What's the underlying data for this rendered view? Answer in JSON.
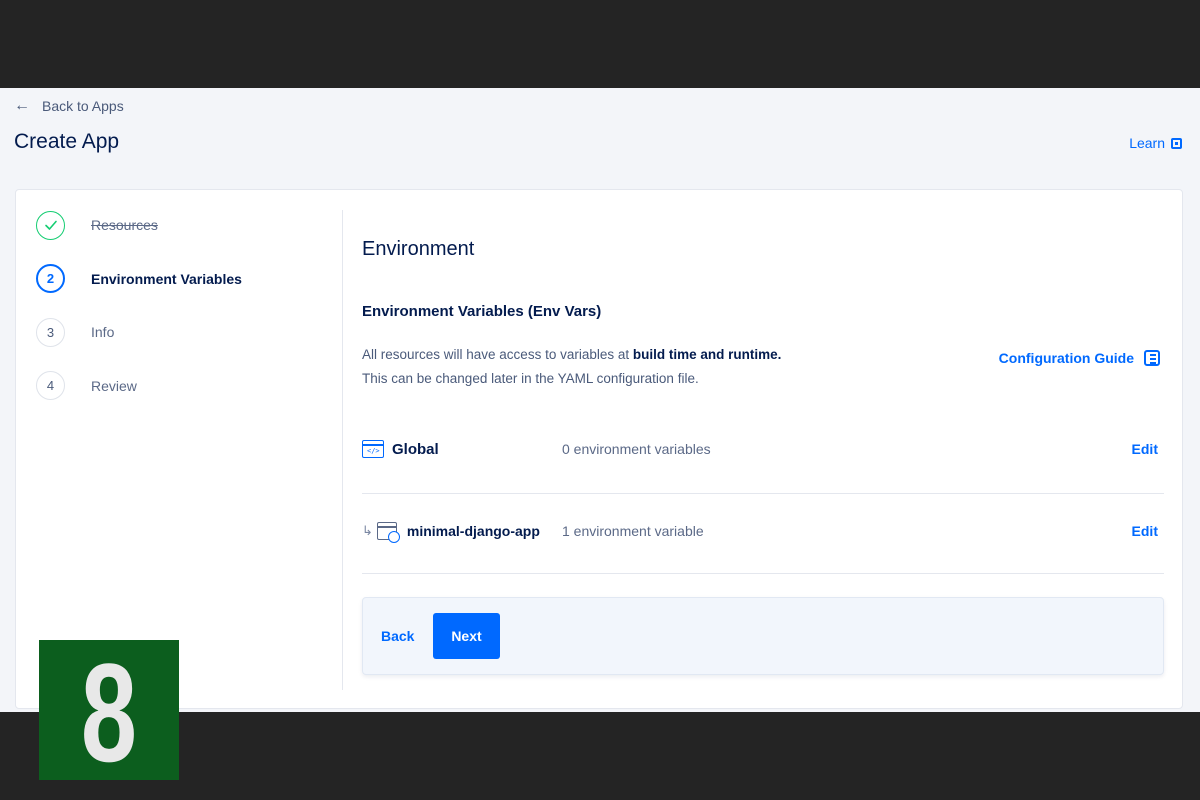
{
  "header": {
    "back_label": "Back to Apps",
    "title": "Create App",
    "learn_label": "Learn"
  },
  "steps": [
    {
      "number": "",
      "label": "Resources",
      "state": "done"
    },
    {
      "number": "2",
      "label": "Environment Variables",
      "state": "active"
    },
    {
      "number": "3",
      "label": "Info",
      "state": "pending"
    },
    {
      "number": "4",
      "label": "Review",
      "state": "pending"
    }
  ],
  "main": {
    "section_title": "Environment",
    "sub_title": "Environment Variables (Env Vars)",
    "desc_line1_prefix": "All resources will have access to variables at ",
    "desc_line1_bold": "build time and runtime.",
    "desc_line2": "This can be changed later in the YAML configuration file.",
    "guide_label": "Configuration Guide",
    "rows": [
      {
        "name": "Global",
        "count": "0 environment variables",
        "edit": "Edit"
      },
      {
        "name": "minimal-django-app",
        "count": "1 environment variable",
        "edit": "Edit"
      }
    ]
  },
  "footer": {
    "back_label": "Back",
    "next_label": "Next"
  },
  "badge": {
    "text": "8",
    "color": "#0c5e1e"
  },
  "colors": {
    "accent": "#0069ff",
    "success": "#15cd72",
    "text": "#031b4e"
  }
}
